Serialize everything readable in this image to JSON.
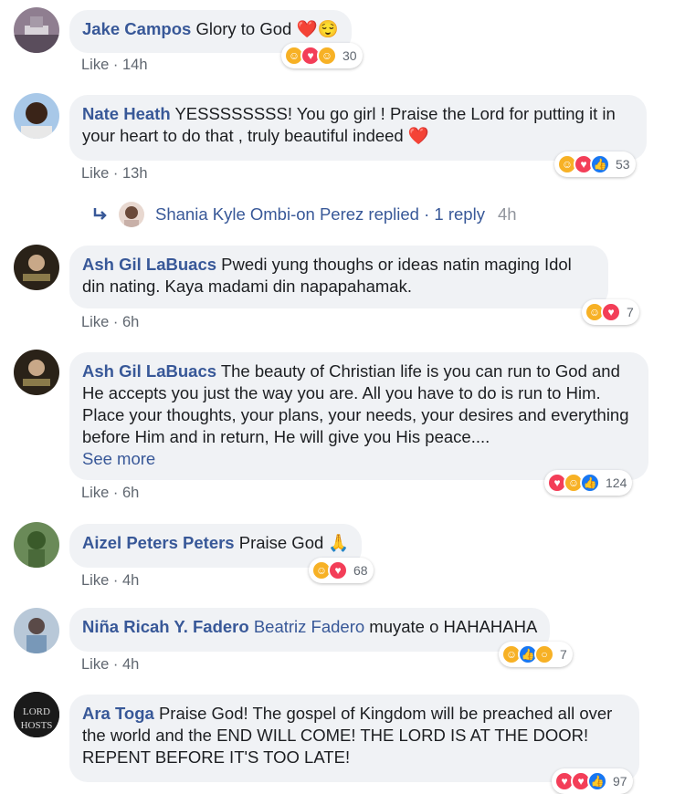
{
  "comments": [
    {
      "author": "Jake Campos",
      "text": "Glory to God",
      "emoji_after": "❤️😌",
      "like": "Like",
      "dot": "·",
      "time": "14h",
      "reactions": [
        "haha",
        "love",
        "care"
      ],
      "count": "30"
    },
    {
      "author": "Nate Heath",
      "text": "YESSSSSSSS! You go girl ! Praise the Lord for putting it in your heart to do that , truly beautiful indeed",
      "emoji_after": "❤️",
      "like": "Like",
      "dot": "·",
      "time": "13h",
      "reactions": [
        "haha",
        "love",
        "like"
      ],
      "count": "53"
    },
    {
      "author": "Ash Gil LaBuacs",
      "text": "Pwedi yung thoughs or ideas natin maging Idol din nating. Kaya madami din napapahamak.",
      "like": "Like",
      "dot": "·",
      "time": "6h",
      "reactions": [
        "haha",
        "love"
      ],
      "count": "7"
    },
    {
      "author": "Ash Gil LaBuacs",
      "text": "The beauty of Christian life is you can run to God and He accepts you just the way you are. All you have to do is run to Him. Place your thoughts, your plans, your needs, your desires and everything before Him and in return, He will give you His peace....",
      "see_more": "See more",
      "like": "Like",
      "dot": "·",
      "time": "6h",
      "reactions": [
        "love",
        "haha",
        "like"
      ],
      "count": "124"
    },
    {
      "author": "Aizel Peters Peters",
      "text": "Praise God",
      "emoji_after": "🙏",
      "like": "Like",
      "dot": "·",
      "time": "4h",
      "reactions": [
        "haha",
        "love"
      ],
      "count": "68"
    },
    {
      "author": "Niña Ricah Y. Fadero",
      "tag": "Beatriz Fadero",
      "text": "muyate o HAHAHAHA",
      "like": "Like",
      "dot": "·",
      "time": "4h",
      "reactions": [
        "haha",
        "like",
        "wow"
      ],
      "count": "7"
    },
    {
      "author": "Ara Toga",
      "text": "Praise God! The gospel of Kingdom will be preached all over the world and the END WILL COME! THE LORD IS AT THE DOOR! REPENT BEFORE IT'S TOO LATE!",
      "count": "97"
    }
  ],
  "reply": {
    "name": "Shania Kyle Ombi-on Perez",
    "action": "replied",
    "dot": "·",
    "count_text": "1 reply",
    "time": "4h"
  },
  "avatar_labels": {
    "ara_line1": "LORD",
    "ara_line2": "HOSTS"
  },
  "colors": {
    "link": "#385898",
    "bubble": "#f0f2f5",
    "meta": "#606770",
    "haha": "#f7b125",
    "love": "#f33e58",
    "like": "#1877f2"
  }
}
